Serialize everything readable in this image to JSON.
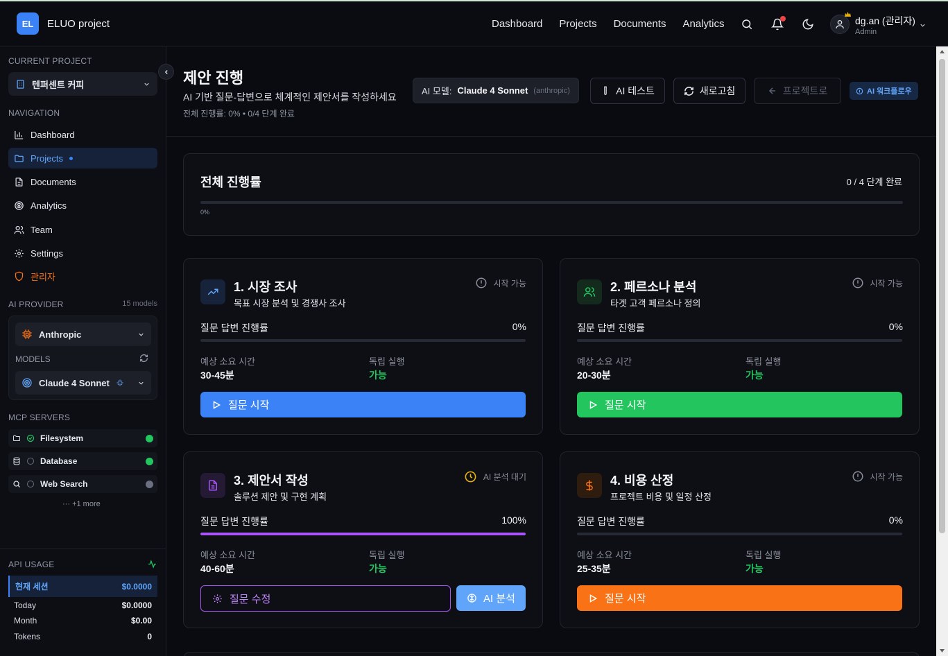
{
  "app": {
    "logo": "EL",
    "title": "ELUO project"
  },
  "topnav": [
    "Dashboard",
    "Projects",
    "Documents",
    "Analytics"
  ],
  "user": {
    "name": "dg.an (관리자)",
    "role": "Admin"
  },
  "sidebar": {
    "current_project_label": "CURRENT PROJECT",
    "current_project": "텐퍼센트 커피",
    "navigation_label": "NAVIGATION",
    "nav": [
      {
        "label": "Dashboard",
        "icon": "bar-chart-icon",
        "active": false
      },
      {
        "label": "Projects",
        "icon": "folder-icon",
        "active": true
      },
      {
        "label": "Documents",
        "icon": "document-icon",
        "active": false
      },
      {
        "label": "Analytics",
        "icon": "target-icon",
        "active": false
      },
      {
        "label": "Team",
        "icon": "users-icon",
        "active": false
      },
      {
        "label": "Settings",
        "icon": "gear-icon",
        "active": false
      },
      {
        "label": "관리자",
        "icon": "shield-icon",
        "active": false
      }
    ],
    "ai_provider_label": "AI PROVIDER",
    "models_count": "15 models",
    "provider": "Anthropic",
    "models_label": "MODELS",
    "model": "Claude 4 Sonnet",
    "mcp_label": "MCP SERVERS",
    "mcp": [
      {
        "name": "Filesystem",
        "status": "connected",
        "status_color": "#22c55e"
      },
      {
        "name": "Database",
        "status": "connected",
        "status_color": "#22c55e"
      },
      {
        "name": "Web Search",
        "status": "disconnected",
        "status_color": "#6b7080"
      }
    ],
    "mcp_more": "+1 more",
    "api_usage_label": "API USAGE",
    "usage": [
      {
        "label": "현재 세션",
        "value": "$0.0000"
      },
      {
        "label": "Today",
        "value": "$0.0000"
      },
      {
        "label": "Month",
        "value": "$0.00"
      },
      {
        "label": "Tokens",
        "value": "0"
      }
    ]
  },
  "page": {
    "title": "제안 진행",
    "subtitle": "AI 기반 질문-답변으로 체계적인 제안서를 작성하세요",
    "progress_text": "전체 진행률: 0% • 0/4 단계 완료",
    "model_pill": {
      "key": "AI 모델:",
      "model": "Claude 4 Sonnet",
      "provider": "(anthropic)"
    },
    "buttons": {
      "ai_test": "AI 테스트",
      "refresh": "새로고침",
      "back": "프로젝트로",
      "workflow": "AI 워크플로우"
    }
  },
  "overall": {
    "title": "전체 진행률",
    "summary": "0 / 4 단계 완료",
    "percent_label": "0%",
    "percent": 0
  },
  "labels": {
    "qa_progress": "질문 답변 진행률",
    "est_time": "예상 소요 시간",
    "independent": "독립 실행"
  },
  "steps": [
    {
      "title": "1. 시장 조사",
      "desc": "목표 시장 분석 및 경쟁사 조사",
      "status": "시작 가능",
      "pct_label": "0%",
      "pct": 0,
      "time": "30-45분",
      "independent": "가능",
      "cta": "질문 시작",
      "accent": "#3b82f6",
      "icon": "trending-up-icon"
    },
    {
      "title": "2. 페르소나 분석",
      "desc": "타겟 고객 페르소나 정의",
      "status": "시작 가능",
      "pct_label": "0%",
      "pct": 0,
      "time": "20-30분",
      "independent": "가능",
      "cta": "질문 시작",
      "accent": "#22c55e",
      "icon": "users-icon"
    },
    {
      "title": "3. 제안서 작성",
      "desc": "솔루션 제안 및 구현 계획",
      "status": "AI 분석 대기",
      "pct_label": "100%",
      "pct": 100,
      "time": "40-60분",
      "independent": "가능",
      "cta": "질문 수정",
      "cta2": "AI 분석",
      "accent": "#a855f7",
      "icon": "document-icon"
    },
    {
      "title": "4. 비용 산정",
      "desc": "프로젝트 비용 및 일정 산정",
      "status": "시작 가능",
      "pct_label": "0%",
      "pct": 0,
      "time": "25-35분",
      "independent": "가능",
      "cta": "질문 시작",
      "accent": "#f97316",
      "icon": "dollar-icon"
    }
  ]
}
